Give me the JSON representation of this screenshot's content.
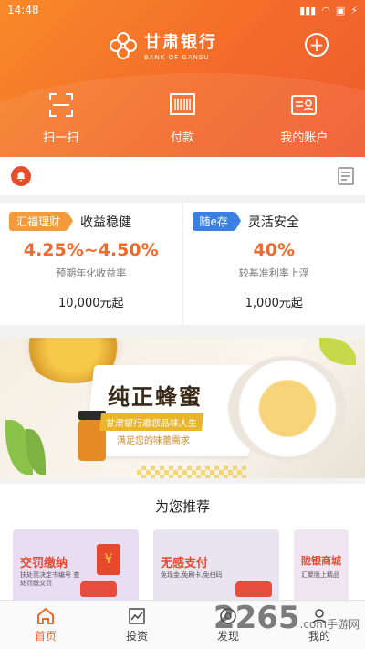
{
  "status_bar": {
    "time": "14:48",
    "battery": "⚡"
  },
  "header": {
    "bank_name_cn": "甘肃银行",
    "bank_name_en": "BANK OF GANSU",
    "add_label": "+"
  },
  "quick_actions": [
    {
      "label": "扫一扫",
      "icon": "scan-icon"
    },
    {
      "label": "付款",
      "icon": "barcode-icon"
    },
    {
      "label": "我的账户",
      "icon": "account-card-icon"
    }
  ],
  "products": [
    {
      "tag": "汇福理财",
      "name": "收益稳健",
      "rate": "4.25%~4.50%",
      "rate_label": "预期年化收益率",
      "amount": "10,000元起",
      "tag_color": "#f39a3c"
    },
    {
      "tag": "随e存",
      "name": "灵活安全",
      "rate": "40%",
      "rate_label": "较基准利率上浮",
      "amount": "1,000元起",
      "tag_color": "#3b7fe0"
    }
  ],
  "banner": {
    "title": "纯正蜂蜜",
    "strip": "甘肃银行邀您品味人生",
    "subtitle": "满足您的味蕾需求"
  },
  "recommend": {
    "title": "为您推荐",
    "cards": [
      {
        "title": "交罚缴纳",
        "subtitle": "扶处罚决定书编号 查处罚缴交罚"
      },
      {
        "title": "无感支付",
        "subtitle": "免现金,免刷卡,免扫码"
      },
      {
        "title": "陇银商城",
        "subtitle": "汇聚陇上精品"
      }
    ]
  },
  "tabbar": {
    "tabs": [
      {
        "label": "首页",
        "active": true
      },
      {
        "label": "投资",
        "active": false
      },
      {
        "label": "发现",
        "active": false
      },
      {
        "label": "我的",
        "active": false
      }
    ]
  },
  "watermark": {
    "brand": "2265",
    "suffix": ".com手游网"
  },
  "colors": {
    "primary": "#ef6a2d",
    "header_start": "#f88a2a",
    "header_end": "#ef5a2e"
  }
}
